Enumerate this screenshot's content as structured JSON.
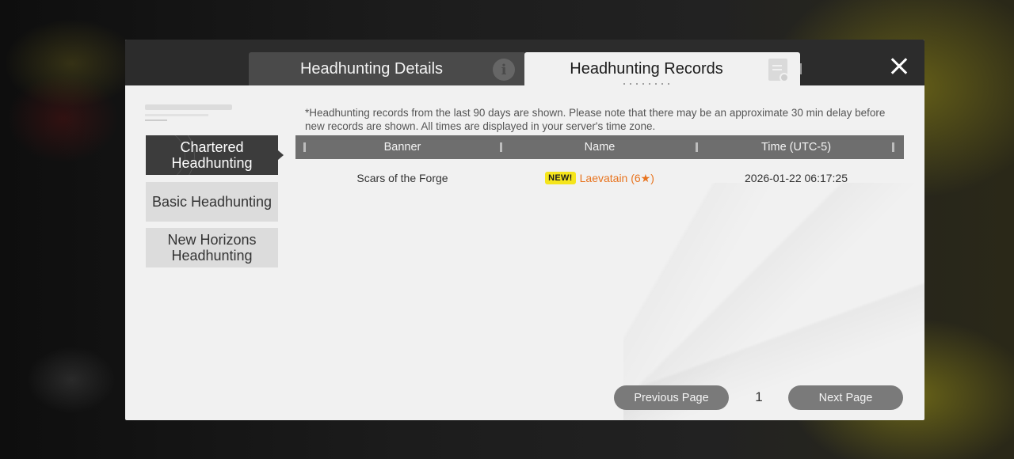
{
  "tabs": [
    {
      "label": "Headhunting Details",
      "icon": "info-icon",
      "active": false
    },
    {
      "label": "Headhunting Records",
      "icon": "document-icon",
      "active": true
    }
  ],
  "sidebar": {
    "items": [
      {
        "label": "Chartered Headhunting",
        "active": true
      },
      {
        "label": "Basic Headhunting",
        "active": false
      },
      {
        "label": "New Horizons Headhunting",
        "active": false
      }
    ]
  },
  "notice": "*Headhunting records from the last 90 days are shown. Please note that there may be an approximate 30 min delay before new records are shown. All times are displayed in your server's time zone.",
  "table": {
    "columns": [
      "Banner",
      "Name",
      "Time (UTC-5)"
    ],
    "rows": [
      {
        "banner": "Scars of the Forge",
        "badge": "NEW!",
        "name": "Laevatain (6★)",
        "time": "2026-01-22 06:17:25"
      }
    ]
  },
  "pagination": {
    "prev_label": "Previous Page",
    "next_label": "Next Page",
    "current_page": "1"
  },
  "colors": {
    "accent_orange": "#e8741f",
    "badge_yellow": "#f5e51c",
    "header_dark": "#2c2c2c"
  }
}
